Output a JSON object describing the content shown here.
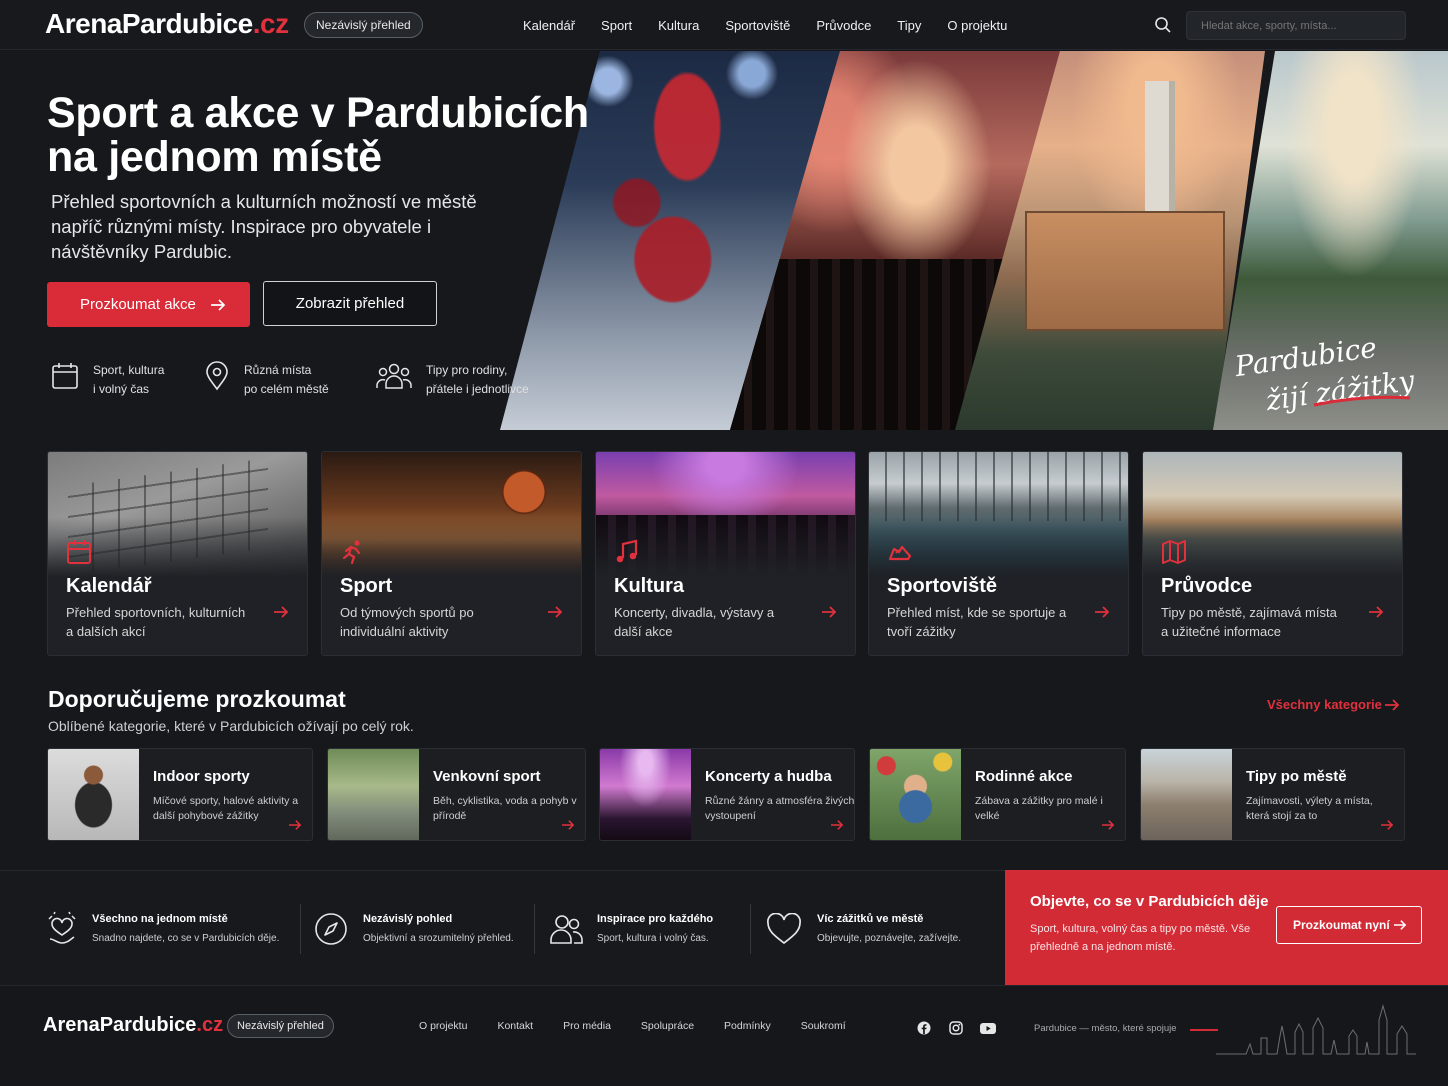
{
  "header": {
    "logo_main": "ArenaPardubice",
    "logo_tld": ".cz",
    "badge": "Nezávislý přehled",
    "menu": [
      "Kalendář",
      "Sport",
      "Kultura",
      "Sportoviště",
      "Průvodce",
      "Tipy",
      "O projektu"
    ],
    "search_placeholder": "Hledat akce, sporty, místa..."
  },
  "hero": {
    "title_line1": "Sport a akce v Pardubicích",
    "title_line2": "na jednom místě",
    "lead": "Přehled sportovních a kulturních možností ve městě napříč různými místy. Inspirace pro obyvatele i návštěvníky Pardubic.",
    "primary_button": "Prozkoumat akce",
    "secondary_button": "Zobrazit přehled",
    "features": [
      {
        "icon": "calendar-icon",
        "line1": "Sport, kultura",
        "line2": "i volný čas"
      },
      {
        "icon": "map-pin-icon",
        "line1": "Různá místa",
        "line2": "po celém městě"
      },
      {
        "icon": "people-icon",
        "line1": "Tipy pro rodiny,",
        "line2": "přátele i jednotlivce"
      }
    ],
    "handwritten_line1": "Pardubice",
    "handwritten_line2": "žijí zážitky"
  },
  "categories": [
    {
      "title": "Kalendář",
      "desc": "Přehled sportovních, kulturních a dalších akcí",
      "icon": "calendar-icon"
    },
    {
      "title": "Sport",
      "desc": "Od týmových sportů po individuální aktivity",
      "icon": "runner-icon"
    },
    {
      "title": "Kultura",
      "desc": "Koncerty, divadla, výstavy a další akce",
      "icon": "music-note-icon"
    },
    {
      "title": "Sportoviště",
      "desc": "Přehled míst, kde se sportuje a tvoří zážitky",
      "icon": "sneaker-icon"
    },
    {
      "title": "Průvodce",
      "desc": "Tipy po městě, zajímavá místa a užitečné informace",
      "icon": "map-icon"
    }
  ],
  "recommended": {
    "heading": "Doporučujeme prozkoumat",
    "subheading": "Oblíbené kategorie, které v Pardubicích ožívají po celý rok.",
    "all_link": "Všechny kategorie",
    "tiles": [
      {
        "title": "Indoor sporty",
        "desc": "Míčové sporty, halové aktivity a další pohybové zážitky"
      },
      {
        "title": "Venkovní sport",
        "desc": "Běh, cyklistika, voda a pohyb v přírodě"
      },
      {
        "title": "Koncerty a hudba",
        "desc": "Různé žánry a atmosféra živých vystoupení"
      },
      {
        "title": "Rodinné akce",
        "desc": "Zábava a zážitky pro malé i velké"
      },
      {
        "title": "Tipy po městě",
        "desc": "Zajímavosti, výlety a místa, která stojí za to"
      }
    ]
  },
  "values": [
    {
      "title": "Všechno na jednom místě",
      "desc": "Snadno najdete, co se v Pardubicích děje.",
      "icon": "hand-heart-icon"
    },
    {
      "title": "Nezávislý pohled",
      "desc": "Objektivní a srozumitelný přehled.",
      "icon": "compass-icon"
    },
    {
      "title": "Inspirace pro každého",
      "desc": "Sport, kultura i volný čas.",
      "icon": "users-icon"
    },
    {
      "title": "Víc zážitků ve městě",
      "desc": "Objevujte, poznávejte, zažívejte.",
      "icon": "heart-icon"
    }
  ],
  "cta": {
    "heading": "Objevte, co se v Pardubicích děje",
    "desc": "Sport, kultura, volný čas a tipy po městě. Vše přehledně a na jednom místě.",
    "button": "Prozkoumat nyní"
  },
  "footer": {
    "logo_main": "ArenaPardubice",
    "logo_tld": ".cz",
    "badge": "Nezávislý přehled",
    "links": [
      "O projektu",
      "Kontakt",
      "Pro média",
      "Spolupráce",
      "Podmínky",
      "Soukromí"
    ],
    "social": [
      "facebook-icon",
      "instagram-icon",
      "youtube-icon"
    ],
    "tagline": "Pardubice — město, které spojuje"
  },
  "colors": {
    "accent": "#d92b38",
    "background": "#16181c",
    "card": "#1f2126"
  }
}
